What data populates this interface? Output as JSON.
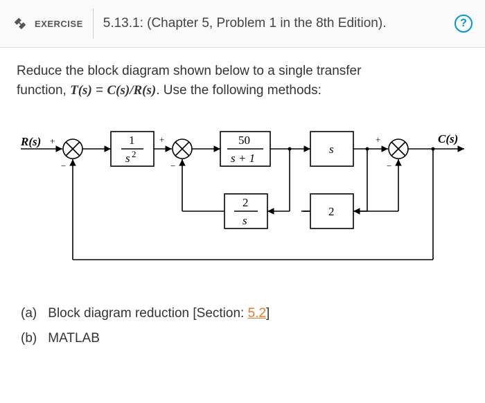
{
  "header": {
    "exercise_label": "EXERCISE",
    "title": "5.13.1: (Chapter 5, Problem 1 in the 8th Edition).",
    "help_glyph": "?"
  },
  "prompt": {
    "line1": "Reduce the block diagram shown below to a single transfer",
    "line2_a": "function, ",
    "eq_T": "T",
    "eq_open": "(",
    "eq_s": "s",
    "eq_close": ")",
    "eq_eq": " = ",
    "eq_C": "C",
    "eq_div": "/",
    "eq_R": "R",
    "line2_b": ". Use the following methods:"
  },
  "diagram": {
    "input_label": "R(s)",
    "output_label": "C(s)",
    "sign_plus": "+",
    "sign_minus": "−",
    "block1_num": "1",
    "block1_den": "s",
    "block1_den_sup": "2",
    "block2_num": "50",
    "block2_den": "s + 1",
    "block3": "s",
    "fb1_num": "2",
    "fb1_den": "s",
    "fb2": "2"
  },
  "methods": {
    "a_letter": "(a)",
    "a_text_1": "Block diagram reduction [Section: ",
    "a_link": "5.2",
    "a_text_2": "]",
    "b_letter": "(b)",
    "b_text": "MATLAB"
  }
}
